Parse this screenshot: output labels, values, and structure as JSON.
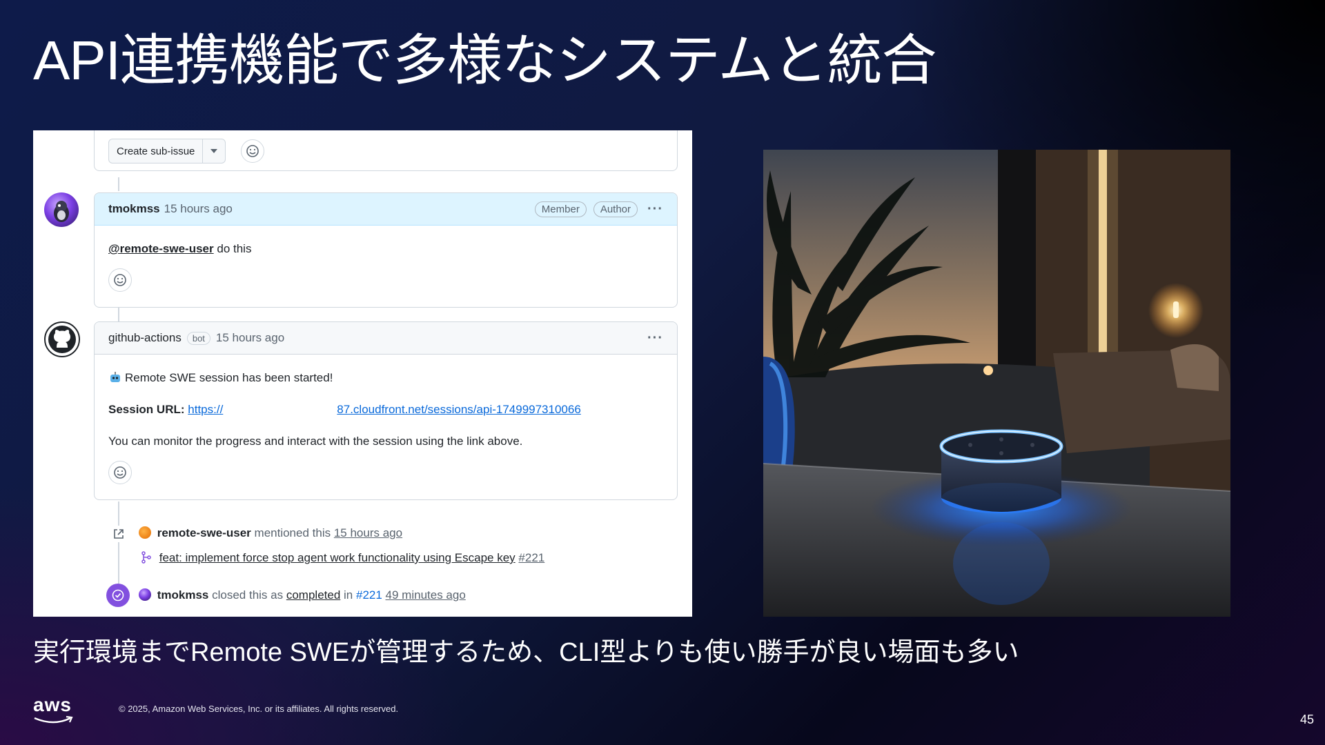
{
  "slide": {
    "title": "API連携機能で多様なシステムと統合",
    "subtitle": "実行環境までRemote SWEが管理するため、CLI型よりも使い勝手が良い場面も多い",
    "footer": {
      "logo_text": "aws",
      "copyright": "© 2025, Amazon Web Services, Inc. or its affiliates. All rights reserved.",
      "page_number": "45"
    }
  },
  "github": {
    "top_card": {
      "create_button": "Create sub-issue"
    },
    "comment1": {
      "user": "tmokmss",
      "time": "15 hours ago",
      "badges": [
        "Member",
        "Author"
      ],
      "mention": "@remote-swe-user",
      "text": "do this"
    },
    "comment2": {
      "user": "github-actions",
      "bot_label": "bot",
      "time": "15 hours ago",
      "line1": "Remote SWE session has been started!",
      "session_label": "Session URL:",
      "url_prefix": "https://",
      "url_suffix": "87.cloudfront.net/sessions/api-1749997310066",
      "line3": "You can monitor the progress and interact with the session using the link above."
    },
    "event1": {
      "user": "remote-swe-user",
      "action": "mentioned this",
      "time": "15 hours ago",
      "pr_title": "feat: implement force stop agent work functionality using Escape key",
      "pr_number": "#221"
    },
    "event2": {
      "user": "tmokmss",
      "action": "closed this as",
      "state": "completed",
      "in_word": "in",
      "ref": "#221",
      "time": "49 minutes ago"
    }
  },
  "colors": {
    "accent_blue": "#0969da",
    "closed_purple": "#8250df",
    "comment_header_blue": "#ddf4ff"
  }
}
